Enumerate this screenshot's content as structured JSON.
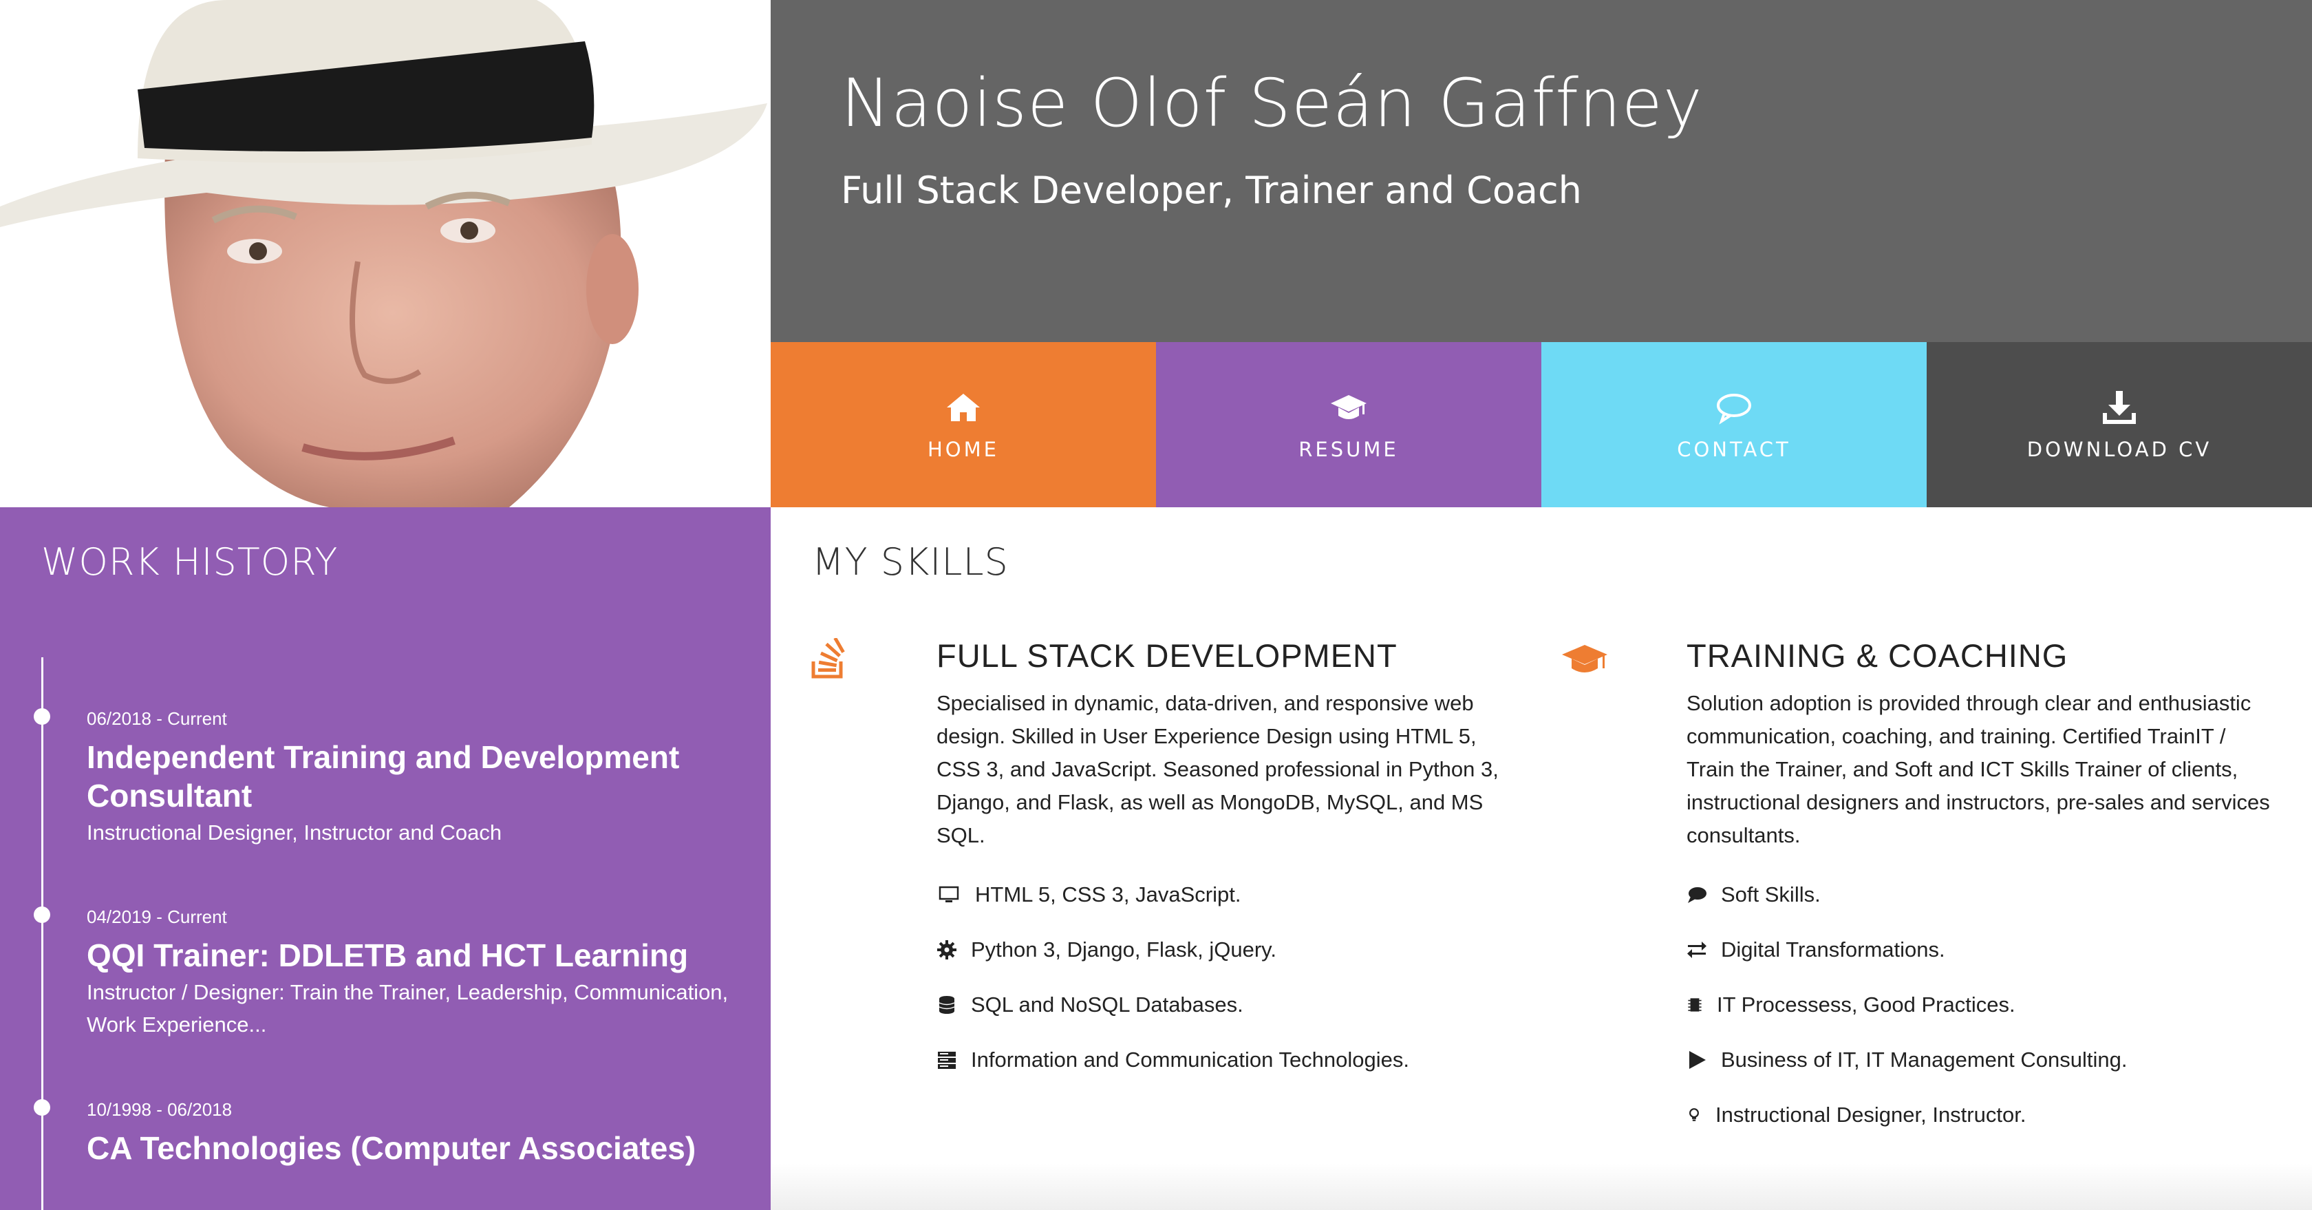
{
  "header": {
    "name": "Naoise Olof Seán Gaffney",
    "tagline": "Full Stack Developer, Trainer and Coach"
  },
  "nav": {
    "items": [
      {
        "label": "HOME",
        "icon": "home-icon",
        "color": "#ee7d32"
      },
      {
        "label": "RESUME",
        "icon": "graduation-cap-icon",
        "color": "#915db3"
      },
      {
        "label": "CONTACT",
        "icon": "speech-bubble-icon",
        "color": "#6edaf5"
      },
      {
        "label": "DOWNLOAD CV",
        "icon": "download-icon",
        "color": "#4d4d4d"
      }
    ]
  },
  "work": {
    "heading": "WORK HISTORY",
    "jobs": [
      {
        "date": "06/2018 - Current",
        "title": "Independent Training and Development Consultant",
        "desc": "Instructional Designer, Instructor and Coach"
      },
      {
        "date": "04/2019 - Current",
        "title": "QQI Trainer: DDLETB and HCT Learning",
        "desc": "Instructor / Designer: Train the Trainer, Leadership, Communication, Work Experience..."
      },
      {
        "date": "10/1998 - 06/2018",
        "title": "CA Technologies (Computer Associates)",
        "desc": ""
      }
    ]
  },
  "skills": {
    "heading": "MY SKILLS",
    "dev": {
      "title": "FULL STACK DEVELOPMENT",
      "intro": "Specialised in dynamic, data-driven, and responsive web design. Skilled in User Experience Design using HTML 5, CSS 3, and JavaScript. Seasoned professional in Python 3, Django, and Flask, as well as MongoDB, MySQL, and MS SQL.",
      "items": [
        {
          "text": "HTML 5, CSS 3, JavaScript.",
          "icon": "monitor-icon"
        },
        {
          "text": "Python 3, Django, Flask, jQuery.",
          "icon": "gear-icon"
        },
        {
          "text": "SQL and NoSQL Databases.",
          "icon": "database-icon"
        },
        {
          "text": "Information and Communication Technologies.",
          "icon": "server-icon"
        }
      ]
    },
    "training": {
      "title": "TRAINING & COACHING",
      "intro": "Solution adoption is provided through clear and enthusiastic communication, coaching, and training. Certified TrainIT / Train the Trainer, and Soft and ICT Skills Trainer of clients, instructional designers and instructors, pre-sales and services consultants.",
      "items": [
        {
          "text": "Soft Skills.",
          "icon": "comment-icon"
        },
        {
          "text": "Digital Transformations.",
          "icon": "exchange-icon"
        },
        {
          "text": "IT Processess, Good Practices.",
          "icon": "chip-icon"
        },
        {
          "text": "Business of IT, IT Management Consulting.",
          "icon": "play-icon"
        },
        {
          "text": "Instructional Designer, Instructor.",
          "icon": "lightbulb-icon"
        }
      ]
    }
  },
  "colors": {
    "accent_orange": "#ee7d32",
    "purple": "#915db3",
    "cyan": "#6edaf5",
    "dark_gray": "#4d4d4d",
    "header_gray": "#656565"
  }
}
